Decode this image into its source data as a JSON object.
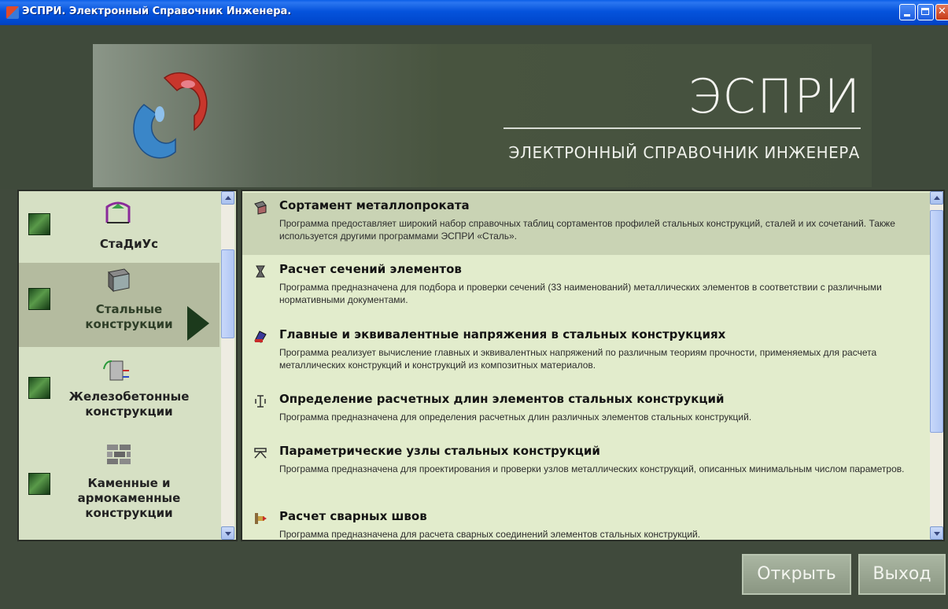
{
  "window": {
    "title": "ЭСПРИ. Электронный Справочник Инженера."
  },
  "header": {
    "brand": "ЭСПРИ",
    "subtitle": "ЭЛЕКТРОННЫЙ СПРАВОЧНИК ИНЖЕНЕРА"
  },
  "categories": [
    {
      "label": "СтаДиУс",
      "icon": "stadium-icon",
      "selected": false
    },
    {
      "label": "Стальные конструкции",
      "icon": "steel-beam-icon",
      "selected": true
    },
    {
      "label": "Железобетонные конструкции",
      "icon": "reinforced-concrete-icon",
      "selected": false
    },
    {
      "label": "Каменные и армокаменные конструкции",
      "icon": "brick-wall-icon",
      "selected": false
    }
  ],
  "programs": [
    {
      "title": "Сортамент металлопроката",
      "icon": "profile-catalog-icon",
      "selected": true,
      "description": "Программа предоставляет широкий набор справочных таблиц сортаментов профилей стальных конструкций, сталей и их сочетаний. Также используется другими программами ЭСПРИ «Сталь»."
    },
    {
      "title": "Расчет сечений элементов",
      "icon": "section-icon",
      "selected": false,
      "description": "Программа предназначена для подбора и проверки сечений (33 наименований) металлических элементов в соответствии с различными нормативными документами."
    },
    {
      "title": "Главные и эквивалентные напряжения в стальных конструкциях",
      "icon": "stress-icon",
      "selected": false,
      "description": "Программа реализует вычисление главных и эквивалентных напряжений по различным теориям прочности, применяемых для расчета металлических конструкций и конструкций из композитных материалов."
    },
    {
      "title": "Определение расчетных длин элементов стальных конструкций",
      "icon": "length-icon",
      "selected": false,
      "description": "Программа предназначена для определения расчетных длин различных элементов стальных конструкций."
    },
    {
      "title": "Параметрические узлы стальных конструкций",
      "icon": "node-icon",
      "selected": false,
      "description": "Программа предназначена для проектирования и проверки узлов металлических конструкций, описанных минимальным числом параметров."
    },
    {
      "title": "Расчет сварных швов",
      "icon": "weld-icon",
      "selected": false,
      "description": "Программа предназначена для расчета сварных соединений элементов стальных конструкций."
    }
  ],
  "buttons": {
    "open": "Открыть",
    "exit": "Выход"
  }
}
